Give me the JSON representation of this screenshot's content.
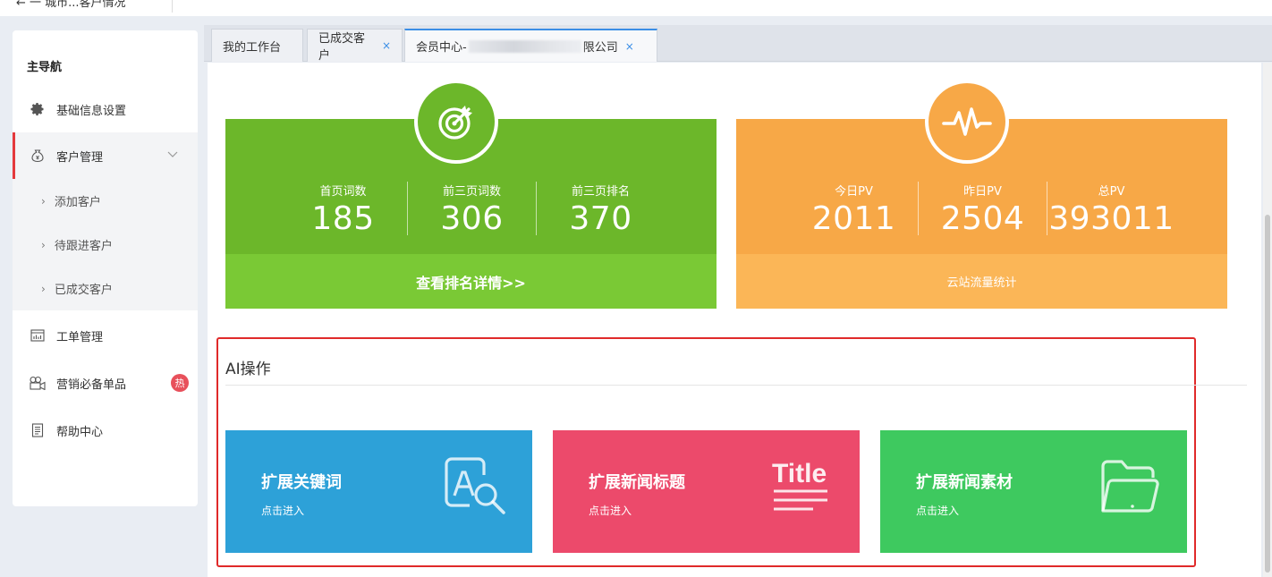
{
  "topbar": {
    "crumb": "← 一 城市...客户情况"
  },
  "sidebar": {
    "title": "主导航",
    "items": [
      {
        "label": "基础信息设置",
        "icon": "gear-icon"
      },
      {
        "label": "客户管理",
        "icon": "money-bag-icon"
      },
      {
        "label": "工单管理",
        "icon": "report-icon"
      },
      {
        "label": "营销必备单品",
        "icon": "camera-icon",
        "badge": "热"
      },
      {
        "label": "帮助中心",
        "icon": "document-icon"
      }
    ],
    "sub_items": [
      "添加客户",
      "待跟进客户",
      "已成交客户"
    ]
  },
  "tabs": [
    {
      "label": "我的工作台"
    },
    {
      "label": "已成交客户",
      "close": "×"
    },
    {
      "label_prefix": "会员中心-",
      "label_suffix": "限公司",
      "close": "×"
    }
  ],
  "seo_card": {
    "metrics": [
      {
        "label": "首页词数",
        "value": "185"
      },
      {
        "label": "前三页词数",
        "value": "306"
      },
      {
        "label": "前三页排名",
        "value": "370"
      }
    ],
    "link": "查看排名详情>>",
    "color_top": "#6cb72a",
    "color_bottom": "#7ac935"
  },
  "pv_card": {
    "metrics": [
      {
        "label": "今日PV",
        "value": "2011"
      },
      {
        "label": "昨日PV",
        "value": "2504"
      },
      {
        "label": "总PV",
        "value": "393011"
      }
    ],
    "link": "云站流量统计",
    "color_top": "#f7a847",
    "color_bottom": "#fbb657"
  },
  "ai": {
    "title": "AI操作",
    "cards": [
      {
        "title": "扩展关键词",
        "sub": "点击进入",
        "color": "#2da1d8",
        "icon": "keyword-search-icon"
      },
      {
        "title": "扩展新闻标题",
        "sub": "点击进入",
        "color": "#ec4a6b",
        "icon": "title-icon",
        "icon_text": "Title"
      },
      {
        "title": "扩展新闻素材",
        "sub": "点击进入",
        "color": "#3ec95f",
        "icon": "folder-icon"
      }
    ]
  }
}
